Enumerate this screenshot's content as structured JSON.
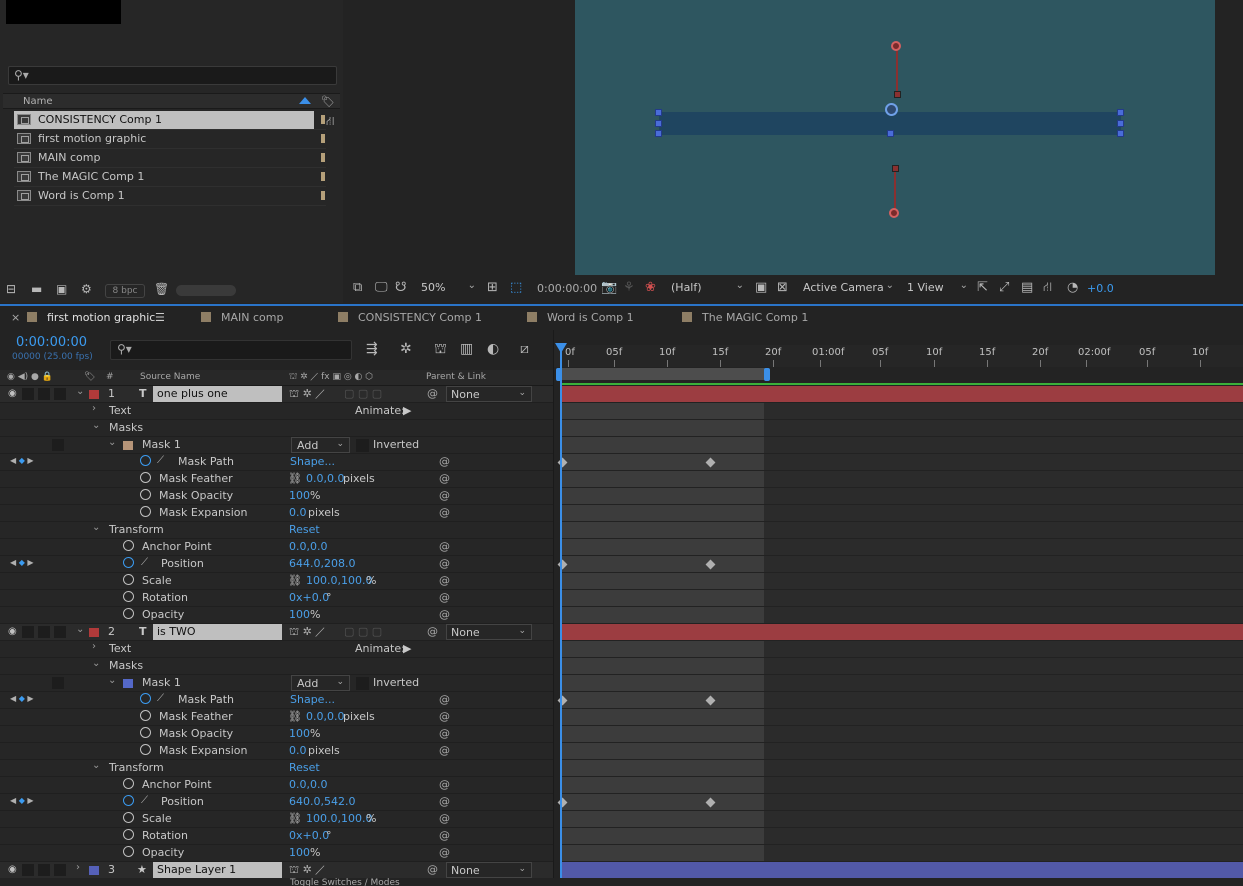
{
  "project": {
    "search_placeholder": "",
    "col_name": "Name",
    "items": [
      {
        "label": "CONSISTENCY Comp 1",
        "selected": true
      },
      {
        "label": "first motion graphic",
        "selected": false
      },
      {
        "label": "MAIN comp",
        "selected": false
      },
      {
        "label": "The MAGIC  Comp 1",
        "selected": false
      },
      {
        "label": "Word is Comp 1",
        "selected": false
      }
    ],
    "bpc": "8 bpc"
  },
  "viewer": {
    "zoom": "50%",
    "timecode": "0:00:00:00",
    "resolution": "(Half)",
    "camera": "Active Camera",
    "views": "1 View",
    "exposure": "+0.0"
  },
  "tabs": [
    {
      "label": "first motion graphic",
      "active": true
    },
    {
      "label": "MAIN comp",
      "active": false
    },
    {
      "label": "CONSISTENCY Comp 1",
      "active": false
    },
    {
      "label": "Word is Comp 1",
      "active": false
    },
    {
      "label": "The MAGIC  Comp 1",
      "active": false
    }
  ],
  "timeline": {
    "timecode": "0:00:00:00",
    "fps": "00000 (25.00 fps)",
    "col_source": "Source Name",
    "col_parent": "Parent & Link",
    "ruler": [
      "0f",
      "05f",
      "10f",
      "15f",
      "20f",
      "01:00f",
      "05f",
      "10f",
      "15f",
      "20f",
      "02:00f",
      "05f",
      "10f"
    ],
    "layers": [
      {
        "num": "1",
        "name": "one plus one",
        "parent": "None",
        "text": "Text",
        "animate": "Animate:",
        "masks": "Masks",
        "mask1": "Mask 1",
        "mode": "Add",
        "inverted": "Inverted",
        "mask_path": "Mask Path",
        "shape": "Shape...",
        "mask_feather": "Mask Feather",
        "feather_val": "0.0,0.0",
        "pixels": "pixels",
        "mask_opacity": "Mask Opacity",
        "mask_opacity_val": "100",
        "pct": "%",
        "mask_expansion": "Mask Expansion",
        "expansion_val": "0.0",
        "transform": "Transform",
        "reset": "Reset",
        "anchor": "Anchor Point",
        "anchor_val": "0.0,0.0",
        "position": "Position",
        "position_val": "644.0,208.0",
        "scale": "Scale",
        "scale_val": "100.0,100.0",
        "rotation": "Rotation",
        "rotation_val": "0x+0.0",
        "deg": "°",
        "opacity": "Opacity",
        "opacity_val": "100"
      },
      {
        "num": "2",
        "name": "is TWO",
        "parent": "None",
        "text": "Text",
        "animate": "Animate:",
        "masks": "Masks",
        "mask1": "Mask 1",
        "mode": "Add",
        "inverted": "Inverted",
        "mask_path": "Mask Path",
        "shape": "Shape...",
        "mask_feather": "Mask Feather",
        "feather_val": "0.0,0.0",
        "pixels": "pixels",
        "mask_opacity": "Mask Opacity",
        "mask_opacity_val": "100",
        "pct": "%",
        "mask_expansion": "Mask Expansion",
        "expansion_val": "0.0",
        "transform": "Transform",
        "reset": "Reset",
        "anchor": "Anchor Point",
        "anchor_val": "0.0,0.0",
        "position": "Position",
        "position_val": "640.0,542.0",
        "scale": "Scale",
        "scale_val": "100.0,100.0",
        "rotation": "Rotation",
        "rotation_val": "0x+0.0",
        "deg": "°",
        "opacity": "Opacity",
        "opacity_val": "100"
      },
      {
        "num": "3",
        "name": "Shape Layer 1",
        "parent": "None"
      }
    ],
    "footer": "Toggle Switches / Modes"
  },
  "colors": {
    "accent": "#3b9bf0",
    "layer_red": "#9c3d41",
    "layer_purple": "#5259a8",
    "canvas": "#2e5660"
  }
}
